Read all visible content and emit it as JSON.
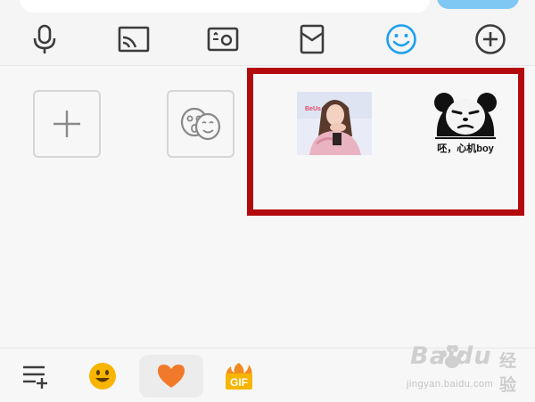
{
  "toolbar": {
    "icons": [
      "microphone-icon",
      "screen-cast-icon",
      "photo-icon",
      "red-packet-icon",
      "emoji-icon",
      "more-plus-icon"
    ],
    "active_icon": "emoji-icon",
    "active_color": "#1da0ee"
  },
  "emoji_panel": {
    "tiles": [
      {
        "name": "add-sticker-tile",
        "icon": "plus-icon"
      },
      {
        "name": "sticker-manage-tile",
        "icon": "masks-icon"
      }
    ],
    "stickers": [
      {
        "name": "girl-photo-sticker",
        "overlay_text": "BeUs"
      },
      {
        "name": "panda-meme-sticker",
        "caption": "呸，心机boy"
      }
    ],
    "highlight_color": "#b30a0e"
  },
  "bottom_bar": {
    "icons": [
      "emoji-list-icon",
      "smiley-face-icon",
      "heart-icon",
      "gif-icon"
    ],
    "selected": "heart-icon",
    "gif_label": "GIF"
  },
  "watermark": {
    "brand": "Baidu",
    "tail": "经验",
    "url": "jingyan.baidu.com"
  },
  "colors": {
    "accent": "#1da0ee",
    "heart": "#f07a2a",
    "smiley": "#f7b500",
    "icon_gray": "#3c3c3c"
  }
}
